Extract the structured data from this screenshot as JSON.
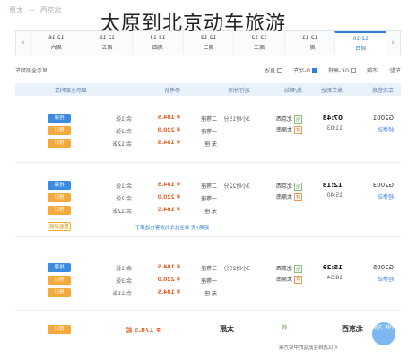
{
  "overlay_title": "太原到北京动车旅游",
  "route": {
    "from": "北京西",
    "to": "太原",
    "arrow": "→"
  },
  "date_tabs": [
    {
      "date": "12-10",
      "day": "周日"
    },
    {
      "date": "12-11",
      "day": "周一"
    },
    {
      "date": "12-12",
      "day": "周二"
    },
    {
      "date": "12-13",
      "day": "周三"
    },
    {
      "date": "12-14",
      "day": "周四"
    },
    {
      "date": "12-15",
      "day": "周五"
    },
    {
      "date": "12-16",
      "day": "周六"
    }
  ],
  "date_nav": {
    "prev": "‹",
    "next": "›"
  },
  "filters": {
    "type_label": "车型:",
    "type_value": "不限",
    "gc_label": "GC-高铁",
    "d_label": "D-动车",
    "direct_label": "直达",
    "right_label": "显示全部列车"
  },
  "columns": {
    "train": "车次信息",
    "dep_arr": "发车到达",
    "station": "发/到站",
    "duration": "运行时间",
    "seat": "参考价",
    "price": "",
    "avail": "",
    "action": "显示全部列车"
  },
  "trains": [
    {
      "no": "G2001",
      "stop": "经停站",
      "dep": "07:48",
      "arr": "11:03",
      "from": "北京西",
      "to": "太原南",
      "duration": "3小时15分",
      "seats": [
        {
          "class": "二等座",
          "price": "¥ 184.5",
          "avail": "余:1张"
        },
        {
          "class": "一等座",
          "price": "¥ 220.0",
          "avail": "余:2张"
        },
        {
          "class": "无 座",
          "price": "¥ 184.5",
          "avail": "余:12张"
        }
      ],
      "buttons": [
        "抢票",
        "预订",
        "预订"
      ]
    },
    {
      "no": "G2003",
      "stop": "经停站",
      "dep": "12:18",
      "arr": "15:40",
      "from": "北京西",
      "to": "太原南",
      "duration": "3小时22分",
      "seats": [
        {
          "class": "二等座",
          "price": "¥ 184.5",
          "avail": "余:1张"
        },
        {
          "class": "一等座",
          "price": "¥ 220.0",
          "avail": "余:2张"
        },
        {
          "class": "无 座",
          "price": "¥ 184.5",
          "avail": "余:12张"
        }
      ],
      "buttons": [
        "抢票",
        "预订",
        "预订"
      ],
      "note": "距离7天 乘坐此车的游客也选择了",
      "extra_button": "查看详情"
    },
    {
      "no": "G2005",
      "stop": "经停站",
      "dep": "15:29",
      "arr": "18:54",
      "from": "北京西",
      "to": "太原南",
      "duration": "3小时25分",
      "seats": [
        {
          "class": "二等座",
          "price": "¥ 184.5",
          "avail": "余:1张"
        },
        {
          "class": "一等座",
          "price": "¥ 220.0",
          "avail": "余:3张"
        },
        {
          "class": "无 座",
          "price": "¥ 184.5",
          "avail": "余:11张"
        }
      ],
      "buttons": [
        "抢票",
        "预订",
        "预订"
      ]
    }
  ],
  "summary": {
    "from": "北京西",
    "to": "太原",
    "mid": "转",
    "price": "¥ 178.5 起",
    "button": "预订",
    "note": "可以选择在此站的中转方案",
    "badge": "中转 方案"
  }
}
